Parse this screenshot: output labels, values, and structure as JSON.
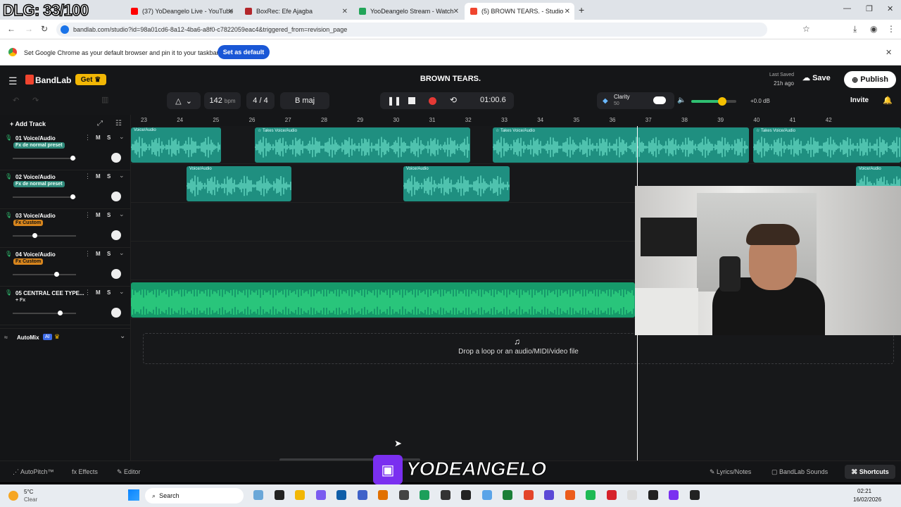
{
  "overlay": {
    "dlg": "DLG: 33/100",
    "brand": "YODEANGELO"
  },
  "browser": {
    "tabs": [
      {
        "title": "(37) YoDeangelo Live - YouTube",
        "color": "#ff0000"
      },
      {
        "title": "BoxRec: Efe Ajagba",
        "color": "#b3262b"
      },
      {
        "title": "YooDeangelo Stream - Watch",
        "color": "#23a559"
      },
      {
        "title": "(5) BROWN TEARS. - Studio",
        "color": "#f0452f"
      }
    ],
    "url": "bandlab.com/studio?id=98a01cd6-8a12-4ba6-a8f0-c7822059eac4&triggered_from=revision_page",
    "infobar": {
      "text": "Set Google Chrome as your default browser and pin it to your taskbar",
      "button": "Set as default"
    }
  },
  "studio": {
    "logo": "BandLab",
    "get_label": "Get",
    "song_title": "BROWN TEARS.",
    "saved_label": "Last Saved",
    "saved_time": "21h ago",
    "save_label": "Save",
    "publish_label": "Publish",
    "invite_label": "Invite",
    "bpm": "142",
    "bpm_unit": "bpm",
    "time_sig_top": "4",
    "time_sig_sep": "/",
    "time_sig_bottom": "4",
    "key": "B maj",
    "time": "01:00.6",
    "clarity_label": "Clarity",
    "clarity_value": "50",
    "gain": "+0.0 dB",
    "add_track": "Add Track",
    "automix": "AutoMix",
    "ai": "AI",
    "drop_text": "Drop a loop or an audio/MIDI/video file",
    "ruler": [
      "23",
      "24",
      "25",
      "26",
      "27",
      "28",
      "29",
      "30",
      "31",
      "32",
      "33",
      "34",
      "35",
      "36",
      "37",
      "38",
      "39",
      "40",
      "41",
      "42"
    ],
    "tracks": [
      {
        "name": "01  Voice/Audio",
        "fx": "Fx de normal preset",
        "vol": 0.95
      },
      {
        "name": "02  Voice/Audio",
        "fx": "Fx de normal preset",
        "vol": 0.95
      },
      {
        "name": "03  Voice/Audio",
        "fx": "Fx Custom",
        "vol": 0.35
      },
      {
        "name": "04  Voice/Audio",
        "fx": "Fx Custom",
        "vol": 0.7
      },
      {
        "name": "05  CENTRAL CEE TYPE...",
        "fx": "+ Fx",
        "vol": 0.75
      }
    ],
    "mute": "M",
    "solo": "S",
    "clip_labels": {
      "takes": "Takes",
      "voice": "Voice/Audio"
    },
    "bottom": {
      "autopitch": "AutoPitch™",
      "effects": "Effects",
      "editor": "Editor",
      "lyrics": "Lyrics/Notes",
      "sounds": "BandLab Sounds",
      "shortcuts": "Shortcuts"
    }
  },
  "taskbar": {
    "temp": "5°C",
    "weather": "Clear",
    "search": "Search",
    "time": "02:21",
    "date": "16/02/2026"
  }
}
